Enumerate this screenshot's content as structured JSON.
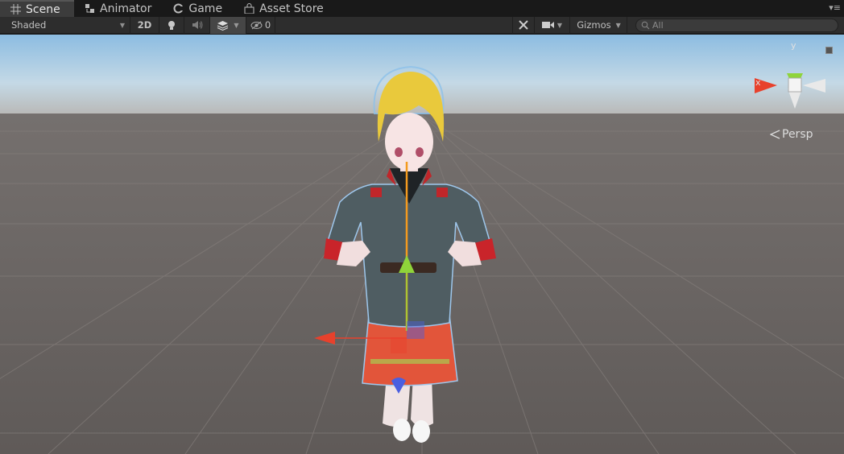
{
  "tabs": [
    {
      "label": "Scene",
      "icon": "grid-icon",
      "active": true
    },
    {
      "label": "Animator",
      "icon": "animator-icon",
      "active": false
    },
    {
      "label": "Game",
      "icon": "game-icon",
      "active": false
    },
    {
      "label": "Asset Store",
      "icon": "store-icon",
      "active": false
    }
  ],
  "toolbar": {
    "shading_mode": "Shaded",
    "mode_2d": "2D",
    "effects_count": "0",
    "gizmos_label": "Gizmos",
    "search_placeholder": "All"
  },
  "viewport": {
    "axis_x": "x",
    "axis_y": "y",
    "projection": "Persp"
  },
  "colors": {
    "sky_top": "#8fbde0",
    "horizon": "#bcbcbc",
    "ground": "#6a6563",
    "x_axis": "#e8412c",
    "y_axis": "#8fd43a",
    "z_axis": "#4a5fe0",
    "selection_outline": "#f39a1f"
  }
}
